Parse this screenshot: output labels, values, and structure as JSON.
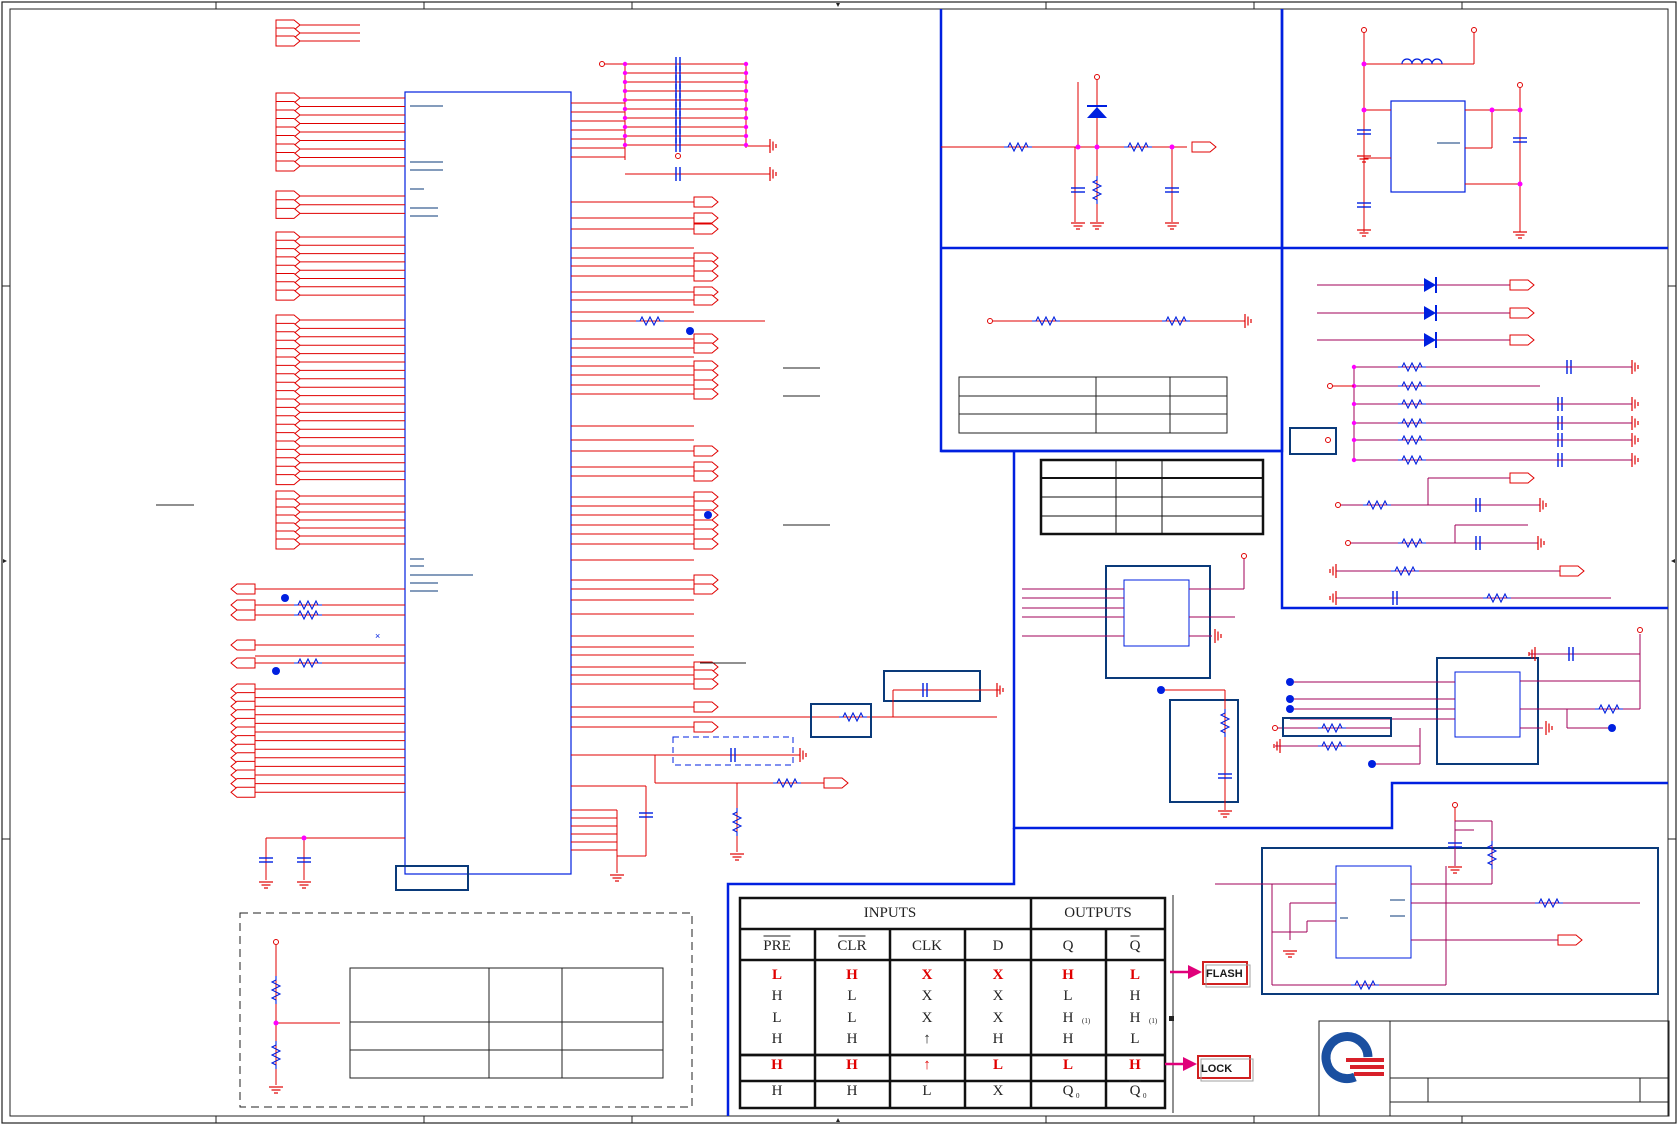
{
  "colors": {
    "wire_red": "#e00000",
    "net_magenta": "#a0005a",
    "box_blue": "#0020e0",
    "frame_navy": "#0a3a7a",
    "junction_magenta": "#ff00ff",
    "callout_arrow": "#e0007a",
    "logo_blue": "#1a4fa0",
    "logo_red": "#d8202a"
  },
  "truth_table": {
    "group_inputs": "INPUTS",
    "group_outputs": "OUTPUTS",
    "headers": [
      "PRE",
      "CLR",
      "CLK",
      "D",
      "Q",
      "Q"
    ],
    "rows": [
      {
        "cells": [
          "L",
          "H",
          "X",
          "X",
          "H",
          "L"
        ],
        "highlight": true
      },
      {
        "cells": [
          "H",
          "L",
          "X",
          "X",
          "L",
          "H"
        ],
        "highlight": false
      },
      {
        "cells": [
          "L",
          "L",
          "X",
          "X",
          "H",
          "H"
        ],
        "highlight": false
      },
      {
        "cells": [
          "H",
          "H",
          "↑",
          "H",
          "H",
          "L"
        ],
        "highlight": false
      },
      {
        "cells": [
          "H",
          "H",
          "↑",
          "L",
          "L",
          "H"
        ],
        "highlight": true
      },
      {
        "cells": [
          "H",
          "H",
          "L",
          "X",
          "Q",
          "Q"
        ],
        "highlight": false
      }
    ],
    "note_mark": "(1)",
    "q0_sub": "0"
  },
  "callouts": [
    {
      "label": "FLASH"
    },
    {
      "label": "LOCK"
    }
  ],
  "icons": {
    "logo": "quanta-logo-icon",
    "ground": "ground-icon",
    "resistor": "resistor-icon",
    "capacitor": "capacitor-icon",
    "diode": "diode-icon",
    "inductor": "inductor-icon"
  }
}
